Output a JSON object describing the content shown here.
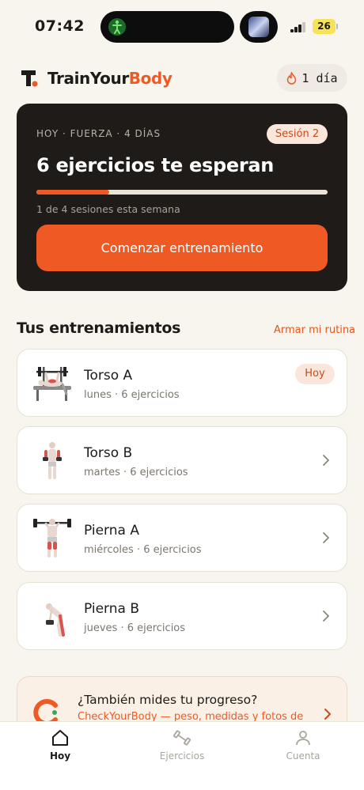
{
  "status_bar": {
    "time": "07:42",
    "battery": "26"
  },
  "header": {
    "brand_plain": "TrainYour",
    "brand_accent": "Body",
    "streak_label": "1 día"
  },
  "hero": {
    "meta": "HOY · FUERZA · 4 DÍAS",
    "session_badge": "Sesión 2",
    "title": "6 ejercicios te esperan",
    "progress_fraction": 0.25,
    "subtitle": "1 de 4 sesiones esta semana",
    "cta_label": "Comenzar entrenamiento"
  },
  "workouts_section": {
    "title": "Tus entrenamientos",
    "link_label": "Armar mi rutina",
    "items": [
      {
        "name": "Torso A",
        "sub": "lunes · 6 ejercicios",
        "badge": "Hoy",
        "icon": "bench-press-icon"
      },
      {
        "name": "Torso B",
        "sub": "martes · 6 ejercicios",
        "icon": "dumbbell-curl-icon"
      },
      {
        "name": "Pierna A",
        "sub": "miércoles · 6 ejercicios",
        "icon": "barbell-squat-icon"
      },
      {
        "name": "Pierna B",
        "sub": "jueves · 6 ejercicios",
        "icon": "deadlift-icon"
      }
    ]
  },
  "promo": {
    "title": "¿También mides tu progreso?",
    "subtitle": "CheckYourBody — peso, medidas y fotos de"
  },
  "tabs": [
    {
      "label": "Hoy",
      "icon": "home-icon"
    },
    {
      "label": "Ejercicios",
      "icon": "dumbbell-icon"
    },
    {
      "label": "Cuenta",
      "icon": "user-icon"
    }
  ],
  "colors": {
    "accent": "#ef5a24",
    "dark": "#1e1b18",
    "background": "#f8f5ef"
  }
}
